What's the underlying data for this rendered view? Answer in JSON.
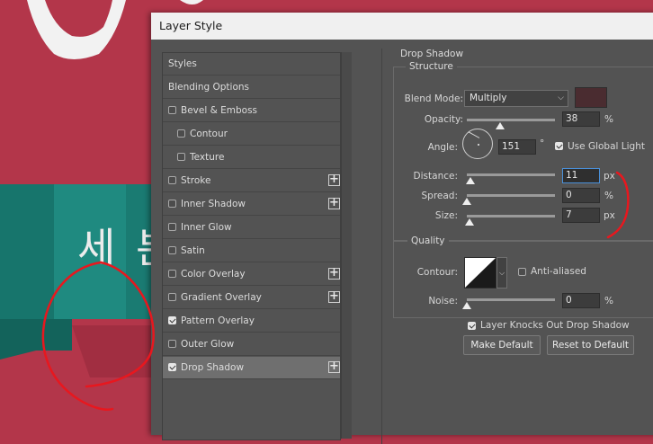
{
  "background": {
    "canvas_color": "#b3364a",
    "teal_color": "#1f8a80",
    "korean_text": "세 븐"
  },
  "dialog": {
    "title": "Layer Style"
  },
  "style_list": {
    "items": [
      {
        "label": "Styles",
        "checkbox": false,
        "checked": false,
        "plus": false,
        "selected": false,
        "indent": "plain"
      },
      {
        "label": "Blending Options",
        "checkbox": false,
        "checked": false,
        "plus": false,
        "selected": false,
        "indent": "plain"
      },
      {
        "label": "Bevel & Emboss",
        "checkbox": true,
        "checked": false,
        "plus": false,
        "selected": false,
        "indent": "top"
      },
      {
        "label": "Contour",
        "checkbox": true,
        "checked": false,
        "plus": false,
        "selected": false,
        "indent": "sub"
      },
      {
        "label": "Texture",
        "checkbox": true,
        "checked": false,
        "plus": false,
        "selected": false,
        "indent": "sub"
      },
      {
        "label": "Stroke",
        "checkbox": true,
        "checked": false,
        "plus": true,
        "selected": false,
        "indent": "top"
      },
      {
        "label": "Inner Shadow",
        "checkbox": true,
        "checked": false,
        "plus": true,
        "selected": false,
        "indent": "top"
      },
      {
        "label": "Inner Glow",
        "checkbox": true,
        "checked": false,
        "plus": false,
        "selected": false,
        "indent": "top"
      },
      {
        "label": "Satin",
        "checkbox": true,
        "checked": false,
        "plus": false,
        "selected": false,
        "indent": "top"
      },
      {
        "label": "Color Overlay",
        "checkbox": true,
        "checked": false,
        "plus": true,
        "selected": false,
        "indent": "top"
      },
      {
        "label": "Gradient Overlay",
        "checkbox": true,
        "checked": false,
        "plus": true,
        "selected": false,
        "indent": "top"
      },
      {
        "label": "Pattern Overlay",
        "checkbox": true,
        "checked": true,
        "plus": false,
        "selected": false,
        "indent": "top"
      },
      {
        "label": "Outer Glow",
        "checkbox": true,
        "checked": false,
        "plus": false,
        "selected": false,
        "indent": "top"
      },
      {
        "label": "Drop Shadow",
        "checkbox": true,
        "checked": true,
        "plus": true,
        "selected": true,
        "indent": "top"
      }
    ]
  },
  "drop_shadow": {
    "title": "Drop Shadow",
    "structure": {
      "title": "Structure",
      "blend_mode_label": "Blend Mode:",
      "blend_mode_value": "Multiply",
      "shadow_color": "#4a2c30",
      "opacity_label": "Opacity:",
      "opacity_value": "38",
      "opacity_fraction": 0.38,
      "opacity_unit": "%",
      "angle_label": "Angle:",
      "angle_value": "151",
      "angle_unit": "°",
      "global_light_label": "Use Global Light",
      "global_light_checked": true,
      "distance_label": "Distance:",
      "distance_value": "11",
      "distance_fraction": 0.04,
      "distance_unit": "px",
      "spread_label": "Spread:",
      "spread_value": "0",
      "spread_fraction": 0.0,
      "spread_unit": "%",
      "size_label": "Size:",
      "size_value": "7",
      "size_fraction": 0.03,
      "size_unit": "px"
    },
    "quality": {
      "title": "Quality",
      "contour_label": "Contour:",
      "anti_aliased_label": "Anti-aliased",
      "anti_aliased_checked": false,
      "noise_label": "Noise:",
      "noise_value": "0",
      "noise_fraction": 0.0,
      "noise_unit": "%"
    },
    "knockout_label": "Layer Knocks Out Drop Shadow",
    "knockout_checked": true,
    "make_default_label": "Make Default",
    "reset_default_label": "Reset to Default"
  },
  "annotation_color": "#e8171e"
}
